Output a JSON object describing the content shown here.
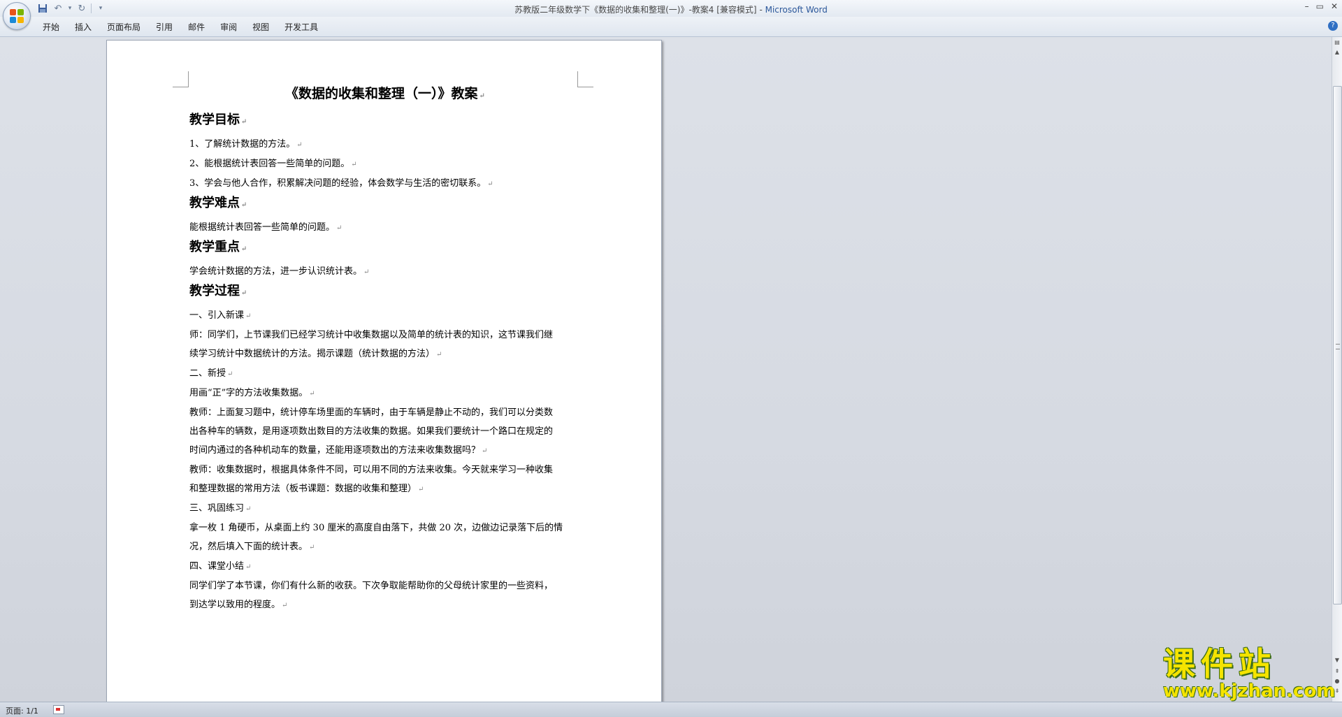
{
  "window": {
    "title": "苏教版二年级数学下《数据的收集和整理(一)》-教案4 [兼容模式]",
    "app_name": "Microsoft Word",
    "title_separator": " - "
  },
  "ribbon": {
    "tabs": [
      "开始",
      "插入",
      "页面布局",
      "引用",
      "邮件",
      "审阅",
      "视图",
      "开发工具"
    ]
  },
  "document": {
    "title": "《数据的收集和整理（一）》教案",
    "heading_goals": "教学目标",
    "goal_1": "1、了解统计数据的方法。",
    "goal_2": "2、能根据统计表回答一些简单的问题。",
    "goal_3": "3、学会与他人合作，积累解决问题的经验，体会数学与生活的密切联系。",
    "heading_difficulty": "教学难点",
    "difficulty_text": "能根据统计表回答一些简单的问题。",
    "heading_focus": "教学重点",
    "focus_text": "学会统计数据的方法，进一步认识统计表。",
    "heading_process": "教学过程",
    "step1_title": "一、引入新课",
    "step1_line1": "师：同学们，上节课我们已经学习统计中收集数据以及简单的统计表的知识，这节课我们继",
    "step1_line2": "续学习统计中数据统计的方法。揭示课题（统计数据的方法）",
    "step2_title": "二、新授",
    "step2_intro": "用画“正”字的方法收集数据。",
    "step2_p1_l1": "教师：上面复习题中，统计停车场里面的车辆时，由于车辆是静止不动的，我们可以分类数",
    "step2_p1_l2": "出各种车的辆数，是用逐项数出数目的方法收集的数据。如果我们要统计一个路口在规定的",
    "step2_p1_l3": "时间内通过的各种机动车的数量，还能用逐项数出的方法来收集数据吗？",
    "step2_p2_l1": "教师：收集数据时，根据具体条件不同，可以用不同的方法来收集。今天就来学习一种收集",
    "step2_p2_l2": "和整理数据的常用方法（板书课题：数据的收集和整理）",
    "step3_title": "三、巩固练习",
    "step3_l1": "拿一枚 1 角硬币，从桌面上约 30 厘米的高度自由落下，共做 20 次，边做边记录落下后的情",
    "step3_l2": "况，然后填入下面的统计表。",
    "step4_title": "四、课堂小结",
    "step4_l1": "同学们学了本节课，你们有什么新的收获。下次争取能帮助你的父母统计家里的一些资料，",
    "step4_l2": "到达学以致用的程度。",
    "para_mark": "↵"
  },
  "statusbar": {
    "page_info": "页面: 1/1"
  },
  "watermark": {
    "chinese": "课件站",
    "url": "www.kjzhan.com"
  }
}
